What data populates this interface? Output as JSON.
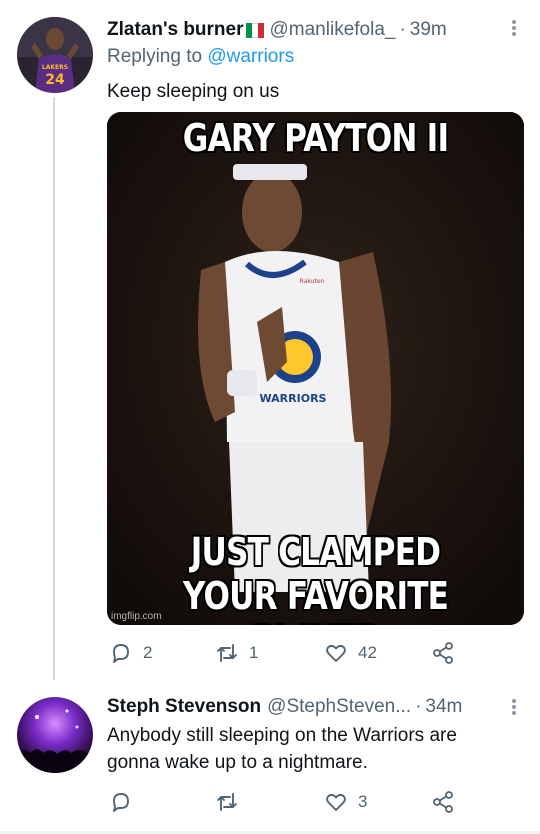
{
  "tweets": [
    {
      "author_name": "Zlatan's burner",
      "author_handle": "@manlikefola_",
      "time": "39m",
      "replying_prefix": "Replying to",
      "replying_to": "@warriors",
      "text": "Keep sleeping on us",
      "avatar_jersey_text": "LAKERS",
      "avatar_jersey_number": "24",
      "media": {
        "top_caption": "GARY PAYTON II",
        "bottom_caption_line1": "JUST CLAMPED",
        "bottom_caption_line2": "YOUR FAVORITE PLAYER",
        "watermark": "imgflip.com",
        "jersey_sponsor": "Rakuten",
        "jersey_text": "WARRIORS"
      },
      "replies": "2",
      "retweets": "1",
      "likes": "42"
    },
    {
      "author_name": "Steph Stevenson",
      "author_handle": "@StephSteven...",
      "time": "34m",
      "text_line1": "Anybody still sleeping on the Warriors are",
      "text_line2": "gonna wake up to a nightmare.",
      "replies": "",
      "retweets": "",
      "likes": "3"
    }
  ],
  "colors": {
    "text_primary": "#0f1419",
    "text_secondary": "#536471",
    "accent": "#1d9bf0",
    "flag_green": "#009246",
    "flag_white": "#ffffff",
    "flag_red": "#ce2b37"
  },
  "icons": [
    "reply-icon",
    "retweet-icon",
    "like-icon",
    "share-icon",
    "more-icon"
  ]
}
